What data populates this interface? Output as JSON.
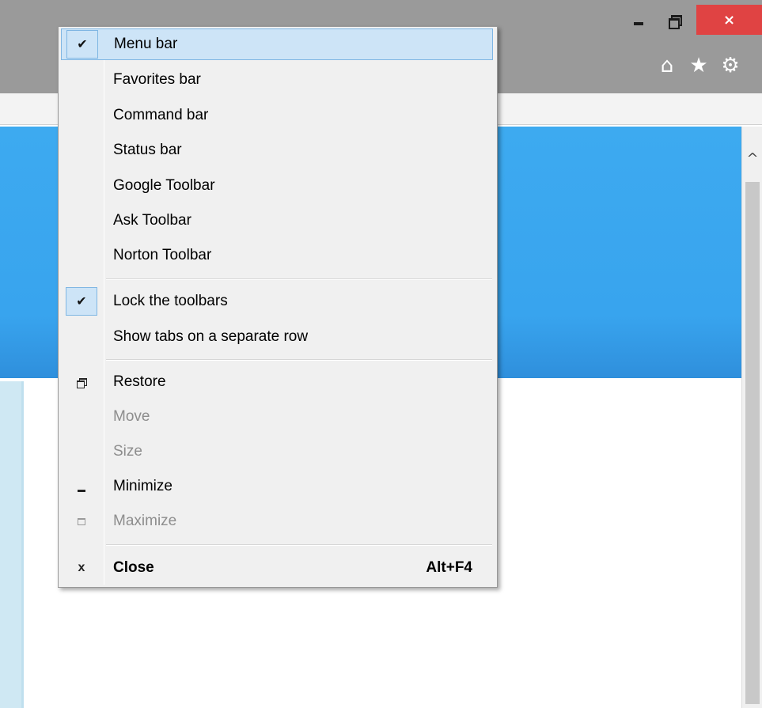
{
  "window": {
    "close_glyph": "×",
    "toolbar_icons": {
      "home": "⌂",
      "favorites": "★",
      "tools": "⚙"
    },
    "scroll_up_glyph": "^"
  },
  "menu": {
    "items": [
      {
        "label": "Menu bar",
        "checked": true,
        "highlighted": true
      },
      {
        "label": "Favorites bar",
        "checked": false
      },
      {
        "label": "Command bar",
        "checked": false
      },
      {
        "label": "Status bar",
        "checked": false
      },
      {
        "label": "Google Toolbar",
        "checked": false
      },
      {
        "label": "Ask Toolbar",
        "checked": false
      },
      {
        "label": "Norton Toolbar",
        "checked": false
      },
      {
        "label": "Lock the toolbars",
        "checked": true
      },
      {
        "label": "Show tabs on a separate row",
        "checked": false
      },
      {
        "label": "Restore",
        "icon": "restore-icon",
        "enabled": true
      },
      {
        "label": "Move",
        "enabled": false
      },
      {
        "label": "Size",
        "enabled": false
      },
      {
        "label": "Minimize",
        "icon": "minimize-icon",
        "enabled": true
      },
      {
        "label": "Maximize",
        "icon": "maximize-icon",
        "enabled": false
      },
      {
        "label": "Close",
        "icon": "close-icon",
        "enabled": true,
        "accelerator": "Alt+F4",
        "bold": true
      }
    ],
    "check_glyph": "✔",
    "close_glyph": "x"
  },
  "colors": {
    "titlebar": "#9a9a9a",
    "close_button": "#e04343",
    "banner": "#3daaf0",
    "menu_background": "#f0f0f0",
    "highlight": "#cde4f7"
  }
}
